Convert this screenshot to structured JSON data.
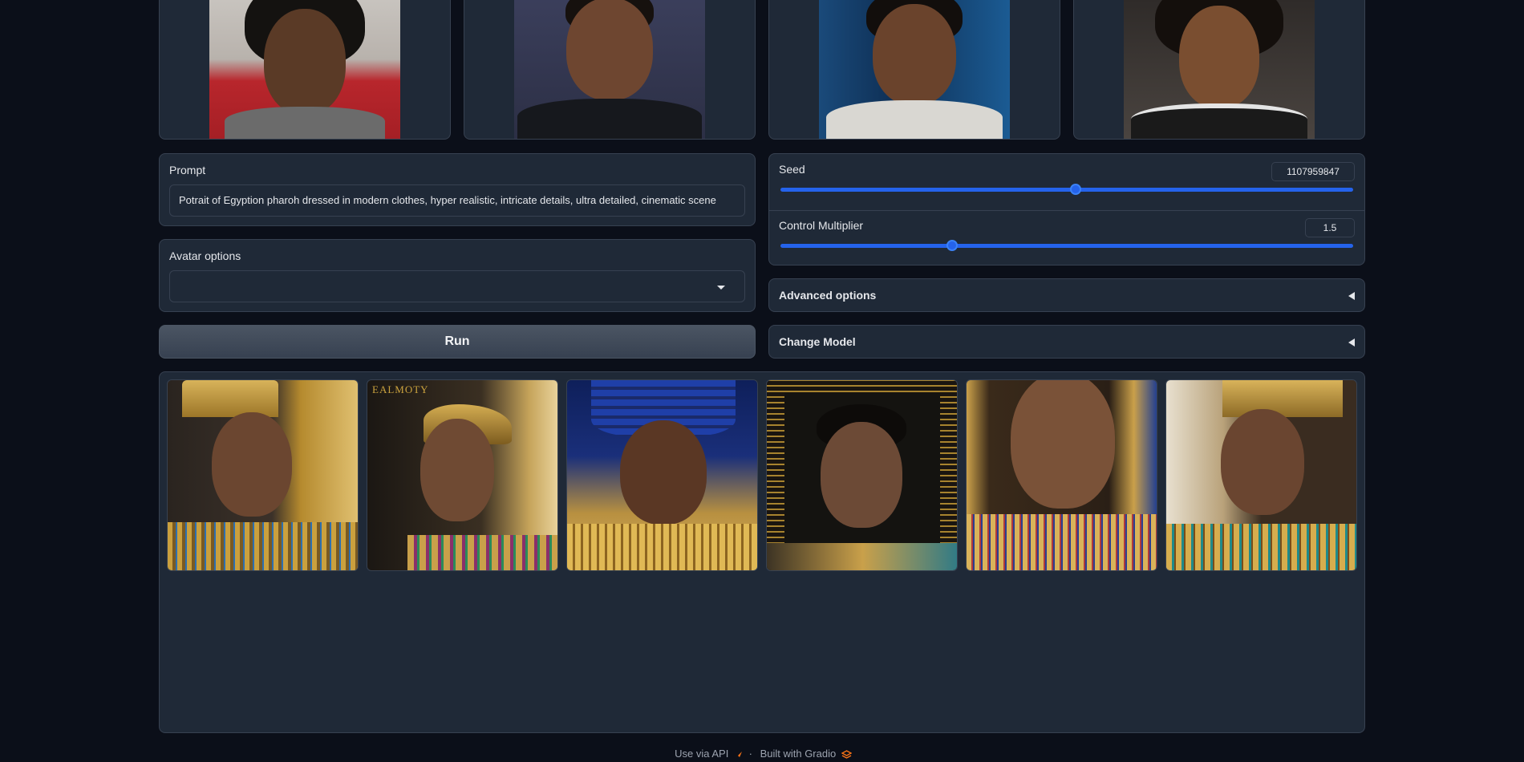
{
  "input_images": [
    {
      "name": "input-image-1"
    },
    {
      "name": "input-image-2"
    },
    {
      "name": "input-image-3"
    },
    {
      "name": "input-image-4"
    }
  ],
  "prompt": {
    "label": "Prompt",
    "value": "Potrait of Egyption pharoh dressed in modern clothes, hyper realistic, intricate details, ultra detailed, cinematic scene"
  },
  "avatar_options": {
    "label": "Avatar options",
    "value": ""
  },
  "run_button": {
    "label": "Run"
  },
  "seed": {
    "label": "Seed",
    "value": "1107959847",
    "fraction": 0.516
  },
  "control_multiplier": {
    "label": "Control Multiplier",
    "value": "1.5",
    "fraction": 0.3
  },
  "advanced_options": {
    "label": "Advanced options"
  },
  "change_model": {
    "label": "Change Model"
  },
  "gallery": {
    "items": [
      {
        "name": "gallery-image-1"
      },
      {
        "name": "gallery-image-2",
        "watermark": "EALMOTY"
      },
      {
        "name": "gallery-image-3"
      },
      {
        "name": "gallery-image-4"
      },
      {
        "name": "gallery-image-5"
      },
      {
        "name": "gallery-image-6"
      }
    ]
  },
  "footer": {
    "api_link": "Use via API",
    "separator": "·",
    "built_with": "Built with Gradio"
  },
  "colors": {
    "background": "#0b0f19",
    "panel": "#1f2937",
    "border": "#374151",
    "accent": "#2563eb",
    "gold": "#c9a24a"
  }
}
